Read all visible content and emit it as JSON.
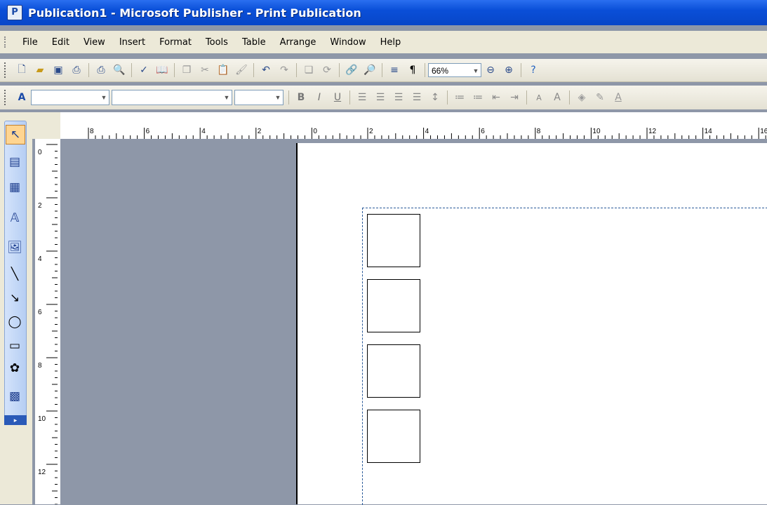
{
  "window": {
    "title": "Publication1 - Microsoft Publisher - Print Publication",
    "app_icon": "publisher-icon"
  },
  "menu": {
    "items": [
      "File",
      "Edit",
      "View",
      "Insert",
      "Format",
      "Tools",
      "Table",
      "Arrange",
      "Window",
      "Help"
    ]
  },
  "standard_toolbar": {
    "zoom": "66%",
    "buttons": [
      "new-icon",
      "open-icon",
      "save-icon",
      "permission-icon",
      "print-icon",
      "print-preview-icon",
      "spelling-icon",
      "research-icon",
      "copy-icon",
      "cut-icon",
      "paste-icon",
      "format-painter-icon",
      "undo-icon",
      "redo-icon",
      "bring-forward-icon",
      "rotate-icon",
      "insert-hyperlink-icon",
      "zoom-page-icon",
      "columns-icon",
      "pilcrow-icon",
      "zoom-out-icon",
      "zoom-in-icon",
      "help-icon"
    ]
  },
  "formatting_toolbar": {
    "style_value": "",
    "font_value": "",
    "size_value": "",
    "buttons": [
      "styles-icon",
      "bold-icon",
      "italic-icon",
      "underline-icon",
      "align-left-icon",
      "center-icon",
      "align-right-icon",
      "justify-icon",
      "line-spacing-icon",
      "numbering-icon",
      "bullets-icon",
      "decrease-indent-icon",
      "increase-indent-icon",
      "decrease-font-icon",
      "increase-font-icon",
      "fill-color-icon",
      "line-color-icon",
      "font-color-icon"
    ]
  },
  "objects_toolbar": {
    "tools": [
      "select-arrow-icon",
      "text-box-icon",
      "table-icon",
      "wordart-icon",
      "picture-icon",
      "line-icon",
      "arrow-icon",
      "oval-icon",
      "rectangle-icon",
      "autoshapes-icon",
      "design-gallery-icon"
    ]
  },
  "rulers": {
    "horizontal_labels": [
      "8",
      "6",
      "4",
      "2",
      "0",
      "2",
      "4",
      "6",
      "8",
      "10",
      "12",
      "14",
      "16"
    ],
    "vertical_labels": [
      "0",
      "2",
      "4",
      "6",
      "8",
      "10",
      "12"
    ]
  },
  "page": {
    "shape_count_visible": 4
  }
}
